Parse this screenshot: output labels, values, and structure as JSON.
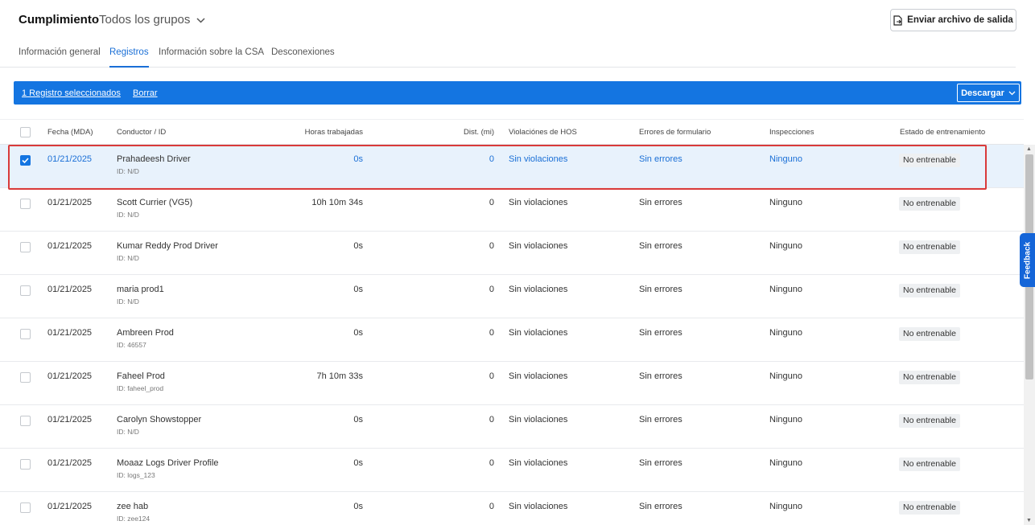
{
  "header": {
    "title": "Cumplimiento",
    "group_select": "Todos los grupos",
    "send_button": "Enviar archivo de salida"
  },
  "tabs": [
    {
      "label": "Información general",
      "active": false
    },
    {
      "label": "Registros",
      "active": true
    },
    {
      "label": "Información sobre la CSA",
      "active": false
    },
    {
      "label": "Desconexiones",
      "active": false
    }
  ],
  "selection_bar": {
    "selected_text": "1 Registro seleccionados",
    "clear_text": "Borrar",
    "download_label": "Descargar"
  },
  "columns": {
    "date": "Fecha (MDA)",
    "driver": "Conductor / ID",
    "hours": "Horas trabajadas",
    "dist": "Dist. (mi)",
    "hos": "Violaciónes de HOS",
    "form_errors": "Errores de formulario",
    "inspections": "Inspecciones",
    "training": "Estado de entrenamiento"
  },
  "rows": [
    {
      "checked": true,
      "date": "01/21/2025",
      "driver": "Prahadeesh Driver",
      "id": "ID: N/D",
      "hours": "0s",
      "dist": "0",
      "hos": "Sin violaciones",
      "form": "Sin errores",
      "insp": "Ninguno",
      "training": "No entrenable"
    },
    {
      "checked": false,
      "date": "01/21/2025",
      "driver": "Scott Currier (VG5)",
      "id": "ID: N/D",
      "hours": "10h 10m 34s",
      "dist": "0",
      "hos": "Sin violaciones",
      "form": "Sin errores",
      "insp": "Ninguno",
      "training": "No entrenable"
    },
    {
      "checked": false,
      "date": "01/21/2025",
      "driver": "Kumar Reddy Prod Driver",
      "id": "ID: N/D",
      "hours": "0s",
      "dist": "0",
      "hos": "Sin violaciones",
      "form": "Sin errores",
      "insp": "Ninguno",
      "training": "No entrenable"
    },
    {
      "checked": false,
      "date": "01/21/2025",
      "driver": "maria prod1",
      "id": "ID: N/D",
      "hours": "0s",
      "dist": "0",
      "hos": "Sin violaciones",
      "form": "Sin errores",
      "insp": "Ninguno",
      "training": "No entrenable"
    },
    {
      "checked": false,
      "date": "01/21/2025",
      "driver": "Ambreen Prod",
      "id": "ID: 46557",
      "hours": "0s",
      "dist": "0",
      "hos": "Sin violaciones",
      "form": "Sin errores",
      "insp": "Ninguno",
      "training": "No entrenable"
    },
    {
      "checked": false,
      "date": "01/21/2025",
      "driver": "Faheel Prod",
      "id": "ID: faheel_prod",
      "hours": "7h 10m 33s",
      "dist": "0",
      "hos": "Sin violaciones",
      "form": "Sin errores",
      "insp": "Ninguno",
      "training": "No entrenable"
    },
    {
      "checked": false,
      "date": "01/21/2025",
      "driver": "Carolyn Showstopper",
      "id": "ID: N/D",
      "hours": "0s",
      "dist": "0",
      "hos": "Sin violaciones",
      "form": "Sin errores",
      "insp": "Ninguno",
      "training": "No entrenable"
    },
    {
      "checked": false,
      "date": "01/21/2025",
      "driver": "Moaaz Logs Driver Profile",
      "id": "ID: logs_123",
      "hours": "0s",
      "dist": "0",
      "hos": "Sin violaciones",
      "form": "Sin errores",
      "insp": "Ninguno",
      "training": "No entrenable"
    },
    {
      "checked": false,
      "date": "01/21/2025",
      "driver": "zee hab",
      "id": "ID: zee124",
      "hours": "0s",
      "dist": "0",
      "hos": "Sin violaciones",
      "form": "Sin errores",
      "insp": "Ninguno",
      "training": "No entrenable"
    }
  ],
  "feedback_label": "Feedback",
  "colors": {
    "accent": "#1475e1",
    "link": "#1a6fd6",
    "selected_row": "#e8f2fc",
    "highlight": "#d93a3a"
  }
}
